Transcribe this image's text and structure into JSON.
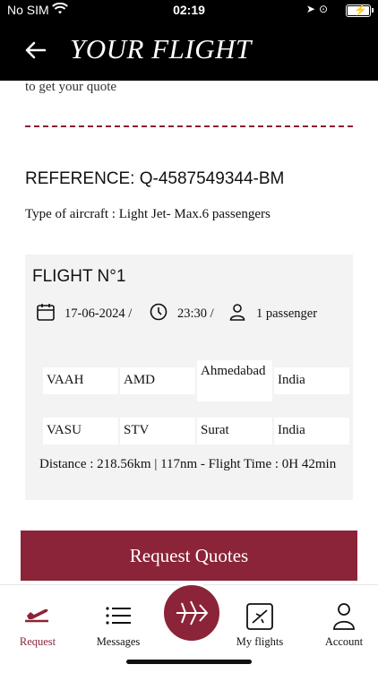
{
  "status_bar": {
    "carrier": "No SIM",
    "time": "02:19"
  },
  "header": {
    "title": "YOUR FLIGHT"
  },
  "content": {
    "intro_text": "to get your quote",
    "reference": "REFERENCE: Q-4587549344-BM",
    "aircraft": "Type of aircraft : Light Jet- Max.6 passengers"
  },
  "flight": {
    "title": "FLIGHT N°1",
    "date": "17-06-2024 /",
    "time": "23:30 /",
    "passengers": "1 passenger",
    "route": [
      {
        "icao": "VAAH",
        "iata": "AMD",
        "city": "Ahmedabad",
        "country": "India"
      },
      {
        "icao": "VASU",
        "iata": "STV",
        "city": "Surat",
        "country": "India"
      }
    ],
    "distance": "Distance : 218.56km | 117nm - Flight Time : 0H 42min"
  },
  "cta": {
    "label": "Request Quotes"
  },
  "tabs": {
    "request": "Request",
    "messages": "Messages",
    "my_flights": "My flights",
    "account": "Account"
  },
  "colors": {
    "accent": "#8b2438",
    "header": "#000000",
    "card": "#f3f3f3"
  },
  "icons": [
    "wifi-icon",
    "location-arrow-icon",
    "rotation-lock-icon",
    "battery-icon",
    "back-arrow-icon",
    "calendar-icon",
    "clock-icon",
    "person-icon",
    "plane-takeoff-icon",
    "list-icon",
    "plane-icon",
    "flight-ticket-icon",
    "account-icon"
  ]
}
